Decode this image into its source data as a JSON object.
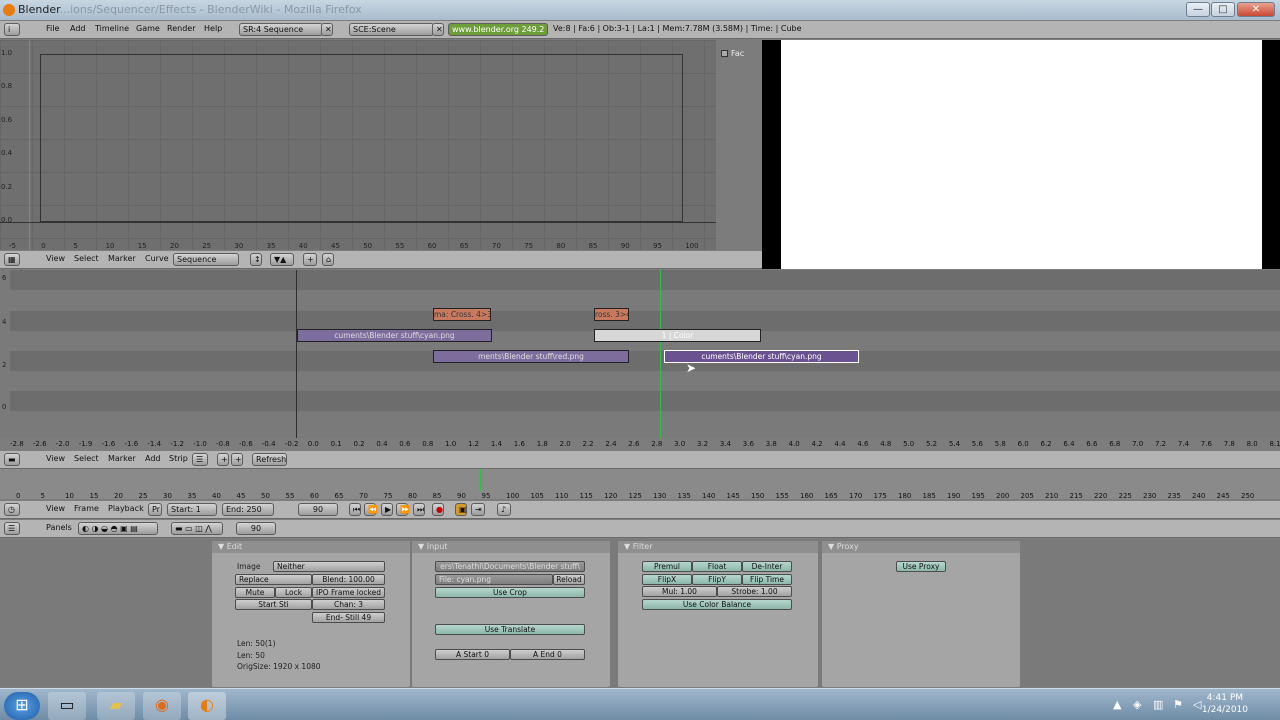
{
  "window": {
    "title": "Blender",
    "title_faded": "...ions/Sequencer/Effects - BlenderWiki - Mozilla Firefox",
    "min": "—",
    "max": "□",
    "close": "✕"
  },
  "top_header": {
    "menus": [
      "File",
      "Add",
      "Timeline",
      "Game",
      "Render",
      "Help"
    ],
    "screen": "SR:4 Sequence",
    "scene": "SCE:Scene",
    "url": "www.blender.org 249.2",
    "stats": "Ve:8 | Fa:6 | Ob:3-1 | La:1 | Mem:7.78M (3.58M) | Time: | Cube"
  },
  "ipo": {
    "fac_label": "Fac",
    "y_ticks": [
      "1.0",
      "0.8",
      "0.6",
      "0.4",
      "0.2",
      "0.0"
    ],
    "x_ticks": [
      "-5",
      "0",
      "5",
      "10",
      "15",
      "20",
      "25",
      "30",
      "35",
      "40",
      "45",
      "50",
      "55",
      "60",
      "65",
      "70",
      "75",
      "80",
      "85",
      "90",
      "95",
      "100"
    ]
  },
  "ipo_header": {
    "menus": [
      "View",
      "Select",
      "Marker",
      "Curve"
    ],
    "mode": "Sequence"
  },
  "sequencer": {
    "y_labels": [
      "6",
      "4",
      "2",
      "0"
    ],
    "strips": {
      "cross1": "ma: Cross. 4>3",
      "cross2": "ross. 3>4",
      "img1": "cuments\\Blender stuff\\cyan.png",
      "color": "1 | Color",
      "img2": "ments\\Blender stuff\\red.png",
      "img3": "cuments\\Blender stuff\\cyan.png"
    },
    "x_ticks": [
      "-2.8",
      "-2.6",
      "-2.0",
      "-1.9",
      "-1.6",
      "-1.6",
      "-1.4",
      "-1.2",
      "-1.0",
      "-0.8",
      "-0.6",
      "-0.4",
      "-0.2",
      "0.0",
      "0.1",
      "0.2",
      "0.4",
      "0.6",
      "0.8",
      "1.0",
      "1.2",
      "1.4",
      "1.6",
      "1.8",
      "2.0",
      "2.2",
      "2.4",
      "2.6",
      "2.8",
      "3.0",
      "3.2",
      "3.4",
      "3.6",
      "3.8",
      "4.0",
      "4.2",
      "4.4",
      "4.6",
      "4.8",
      "5.0",
      "5.2",
      "5.4",
      "5.6",
      "5.8",
      "6.0",
      "6.2",
      "6.4",
      "6.6",
      "6.8",
      "7.0",
      "7.2",
      "7.4",
      "7.6",
      "7.8",
      "8.0",
      "8.1"
    ]
  },
  "seq_header": {
    "menus": [
      "View",
      "Select",
      "Marker",
      "Add",
      "Strip"
    ],
    "refresh": "Refresh"
  },
  "timeline": {
    "x_ticks": [
      "0",
      "5",
      "10",
      "15",
      "20",
      "25",
      "30",
      "35",
      "40",
      "45",
      "50",
      "55",
      "60",
      "65",
      "70",
      "75",
      "80",
      "85",
      "90",
      "95",
      "100",
      "105",
      "110",
      "115",
      "120",
      "125",
      "130",
      "135",
      "140",
      "145",
      "150",
      "155",
      "160",
      "165",
      "170",
      "175",
      "180",
      "185",
      "190",
      "195",
      "200",
      "205",
      "210",
      "215",
      "220",
      "225",
      "230",
      "235",
      "240",
      "245",
      "250"
    ]
  },
  "timeline_header": {
    "menus": [
      "View",
      "Frame",
      "Playback",
      "Pr"
    ],
    "start": "Start: 1",
    "end": "End: 250",
    "current": "90"
  },
  "buttons_header": {
    "panels": "Panels",
    "frame": "90"
  },
  "edit_panel": {
    "title": "Edit",
    "image_label": "Image",
    "image_value": "Neither",
    "replace": "Replace",
    "blend": "Blend: 100.00",
    "mute": "Mute",
    "lock": "Lock",
    "ipo_frame": "IPO Frame locked",
    "start_still": "Start Sti",
    "chan": "Chan: 3",
    "end_still": "End- Still 49",
    "info1": "Len: 50(1)",
    "info2": "Len: 50",
    "info3": "OrigSize: 1920 x 1080"
  },
  "input_panel": {
    "title": "Input",
    "path": "ers\\Tenathi\\Documents\\Blender stuff\\",
    "file": "File: cyan.png",
    "reload": "Reload",
    "use_crop": "Use Crop",
    "use_translate": "Use Translate",
    "start": "A Start 0",
    "end": "A End 0"
  },
  "filter_panel": {
    "title": "Filter",
    "premul": "Premul",
    "float": "Float",
    "deinter": "De-Inter",
    "flipx": "FlipX",
    "flipy": "FlipY",
    "fliptime": "Flip Time",
    "mul": "Mul: 1.00",
    "strobe": "Strobe: 1.00",
    "use_color_balance": "Use Color Balance"
  },
  "proxy_panel": {
    "title": "Proxy",
    "use_proxy": "Use Proxy"
  },
  "taskbar": {
    "time": "4:41 PM",
    "date": "1/24/2010"
  },
  "colors": {
    "green_cursor": "#2fbf4a",
    "strip_purple": "#7d6d9c",
    "strip_cross": "#c97a5e"
  }
}
